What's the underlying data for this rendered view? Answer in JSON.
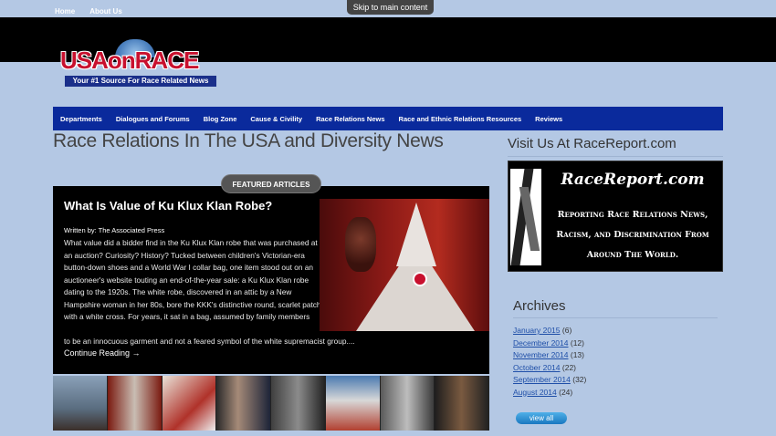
{
  "topbar": {
    "links": [
      "Home",
      "About Us"
    ],
    "skip": "Skip to main content"
  },
  "logo": {
    "word": "USAonRACE",
    "tagline": "Your #1 Source For Race Related News"
  },
  "nav": [
    "Departments",
    "Dialogues and Forums",
    "Blog Zone",
    "Cause & Civility",
    "Race Relations News",
    "Race and Ethnic Relations Resources",
    "Reviews"
  ],
  "main": {
    "heading": "Race Relations In The USA and Diversity News"
  },
  "featured": {
    "badge": "FEATURED ARTICLES",
    "title": "What Is Value of Ku Klux Klan Robe?",
    "byline": "Written by: The Associated Press",
    "body": "What value did a bidder find in the Ku Klux Klan robe that was purchased at an auction? Curiosity? History? Tucked between children's Victorian-era button-down shoes and a World War I collar bag, one item stood out on an auctioneer's website touting an end-of-the-year sale: a Ku Klux Klan robe dating to the 1920s. The white robe, discovered in an attic by a New Hampshire woman in her 80s, bore the KKK's distinctive round, scarlet patch with a white cross. For years, it sat in a bag, assumed by family members",
    "body_end": "to be an innocuous garment and not a feared symbol of the white supremacist group....",
    "continue": "Continue Reading →"
  },
  "sidebar": {
    "heading": "Visit Us At RaceReport.com",
    "ad_title": "RaceReport.com",
    "ad_text": "Reporting Race Relations News, Racism, and Discrimination From Around The World.",
    "archives_title": "Archives",
    "archives": [
      {
        "month": "January 2015",
        "count": "(6)"
      },
      {
        "month": "December 2014",
        "count": "(12)"
      },
      {
        "month": "November 2014",
        "count": "(13)"
      },
      {
        "month": "October 2014",
        "count": "(22)"
      },
      {
        "month": "September 2014",
        "count": "(32)"
      },
      {
        "month": "August 2014",
        "count": "(24)"
      }
    ],
    "view_all": "view all"
  },
  "colors": {
    "background": "#b4c8e4",
    "nav": "#0a2a9c",
    "logo_red": "#c8102e",
    "link": "#1f4fa8"
  }
}
